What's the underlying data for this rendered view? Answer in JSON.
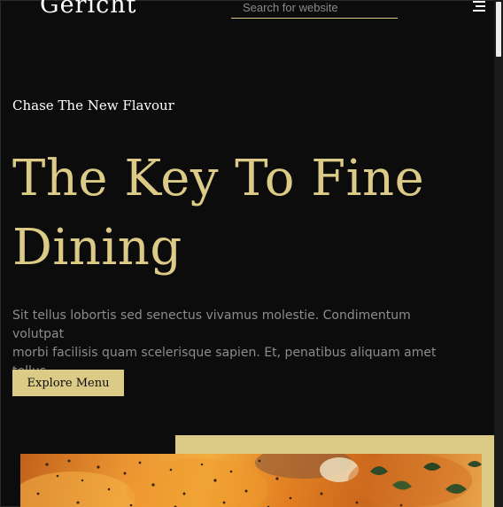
{
  "navbar": {
    "logo": "Gericht",
    "search": {
      "placeholder": "Search for website",
      "value": ""
    },
    "menu_icon": "hamburger-menu-icon"
  },
  "hero": {
    "subtitle": "Chase The New Flavour",
    "headline_line1": "The Key To Fine",
    "headline_line2": "Dining",
    "description_line1": "Sit tellus lobortis sed senectus vivamus molestie. Condimentum volutpat",
    "description_line2": "morbi facilisis quam scelerisque sapien. Et, penatibus aliquam amet tellus",
    "button_label": "Explore Menu"
  },
  "colors": {
    "background": "#0c0c0c",
    "accent_gold": "#dcca87",
    "text_white": "#ffffff",
    "text_grey": "#8c8c8c"
  }
}
